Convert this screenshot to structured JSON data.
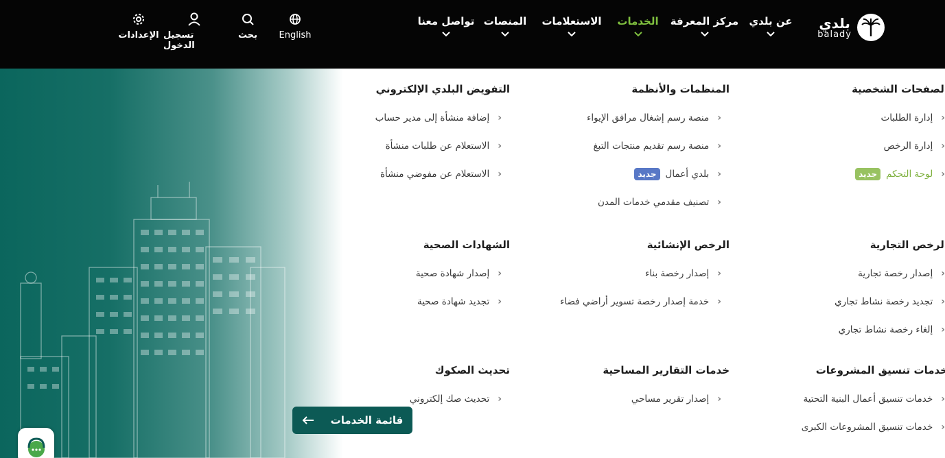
{
  "logo": {
    "arabic": "بلدي",
    "english": "balady"
  },
  "nav": [
    {
      "label": "عن بلدي"
    },
    {
      "label": "مركز المعرفة"
    },
    {
      "label": "الخدمات",
      "active": true
    },
    {
      "label": "الاستعلامات"
    },
    {
      "label": "المنصات"
    },
    {
      "label": "تواصل معنا"
    }
  ],
  "tools": {
    "language": "English",
    "search": "بحث",
    "login": "تسجيل الدخول",
    "settings": "الإعدادات"
  },
  "colors": {
    "active_nav": "#7fbf3f",
    "cta_bg": "#0c5a55",
    "badge_blue": "#5878c6",
    "badge_green": "#98c261"
  },
  "sections": {
    "personal": {
      "title": "الصفحات الشخصية",
      "links": [
        "إدارة الطلبات",
        "إدارة الرخص",
        "لوحة التحكم"
      ],
      "dashboard_badge": "جديد"
    },
    "platforms": {
      "title": "المنظمات والأنظمة",
      "links": [
        "منصة رسم إشغال مرافق الإيواء",
        "منصة رسم تقديم منتجات التبغ",
        "بلدي أعمال",
        "تصنيف مقدمي خدمات المدن"
      ],
      "amal_badge": "جديد"
    },
    "delegation": {
      "title": "التفويض البلدي الإلكتروني",
      "links": [
        "إضافة منشأة إلى مدير حساب",
        "الاستعلام عن طلبات منشأة",
        "الاستعلام عن مفوضي منشأة"
      ]
    },
    "commercial": {
      "title": "الرخص التجارية",
      "links": [
        "إصدار رخصة تجارية",
        "تجديد رخصة نشاط تجاري",
        "إلغاء رخصة نشاط تجاري"
      ]
    },
    "construction": {
      "title": "الرخص الإنشائية",
      "links": [
        "إصدار رخصة بناء",
        "خدمة إصدار رخصة تسوير أراضي فضاء"
      ]
    },
    "health": {
      "title": "الشهادات الصحية",
      "links": [
        "إصدار شهادة صحية",
        "تجديد شهادة صحية"
      ]
    },
    "projects": {
      "title": "خدمات تنسيق المشروعات",
      "links": [
        "خدمات تنسيق أعمال البنية التحتية",
        "خدمات تنسيق المشروعات الكبرى"
      ]
    },
    "survey": {
      "title": "خدمات التقارير المساحية",
      "links": [
        "إصدار تقرير مساحي"
      ]
    },
    "deeds": {
      "title": "تحديث الصكوك",
      "links": [
        "تحديث صك إلكتروني"
      ]
    }
  },
  "cta": {
    "label": "قائمة الخدمات"
  },
  "icons": {
    "arrow": "left-arrow-icon",
    "chat": "chat-support-icon",
    "chevron": "chevron-left-icon"
  }
}
